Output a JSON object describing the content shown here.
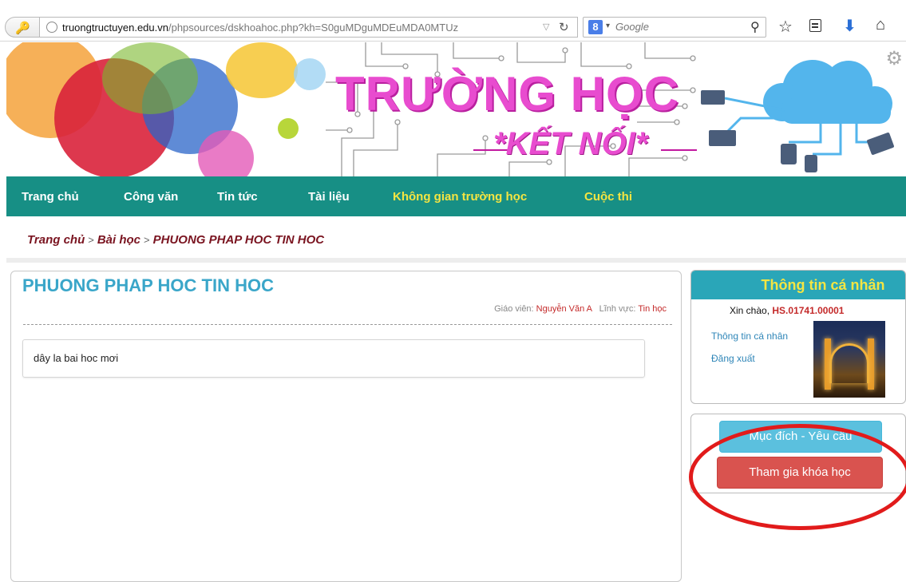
{
  "browser": {
    "url_host": "truongtructuyen.edu.vn",
    "url_path": "/phpsources/dskhoahoc.php?kh=S0guMDguMDEuMDA0MTUz",
    "search_placeholder": "Google",
    "icons": [
      "key-icon",
      "globe-icon",
      "reload-icon",
      "google-icon",
      "search-icon",
      "star-icon",
      "reader-icon",
      "download-icon",
      "home-icon"
    ]
  },
  "banner": {
    "title": "TRƯỜNG HỌC",
    "subtitle": "*KẾT NỐI*"
  },
  "nav": {
    "items": [
      {
        "label": "Trang chủ"
      },
      {
        "label": "Công văn"
      },
      {
        "label": "Tin tức"
      },
      {
        "label": "Tài liệu"
      },
      {
        "label": "Không gian trường học"
      },
      {
        "label": "Cuộc thi"
      }
    ],
    "active_color": "#f4e542",
    "bg_color": "#178f85"
  },
  "breadcrumb": {
    "items": [
      "Trang chủ",
      "Bài học",
      "PHUONG PHAP HOC TIN HOC"
    ],
    "separator": ">"
  },
  "course": {
    "title": "PHUONG PHAP HOC TIN HOC",
    "teacher_label": "Giáo viên:",
    "teacher": "Nguyễn Văn A",
    "field_label": "Lĩnh vực:",
    "field": "Tin học",
    "lesson_text": "dây la bai hoc mơi"
  },
  "profile": {
    "title": "Thông tin cá nhân",
    "greeting": "Xin chào,",
    "user_id": "HS.01741.00001",
    "links": [
      "Thông tin cá nhân",
      "Đăng xuất"
    ]
  },
  "actions": {
    "goals_label": "Mục đích - Yêu cầu",
    "join_label": "Tham gia khóa học"
  },
  "colors": {
    "accent": "#3aa6c9",
    "profile_head": "#2aa6b8",
    "join_button": "#d9534f",
    "goals_button": "#5bc0de",
    "annotation": "#e11b1b"
  }
}
